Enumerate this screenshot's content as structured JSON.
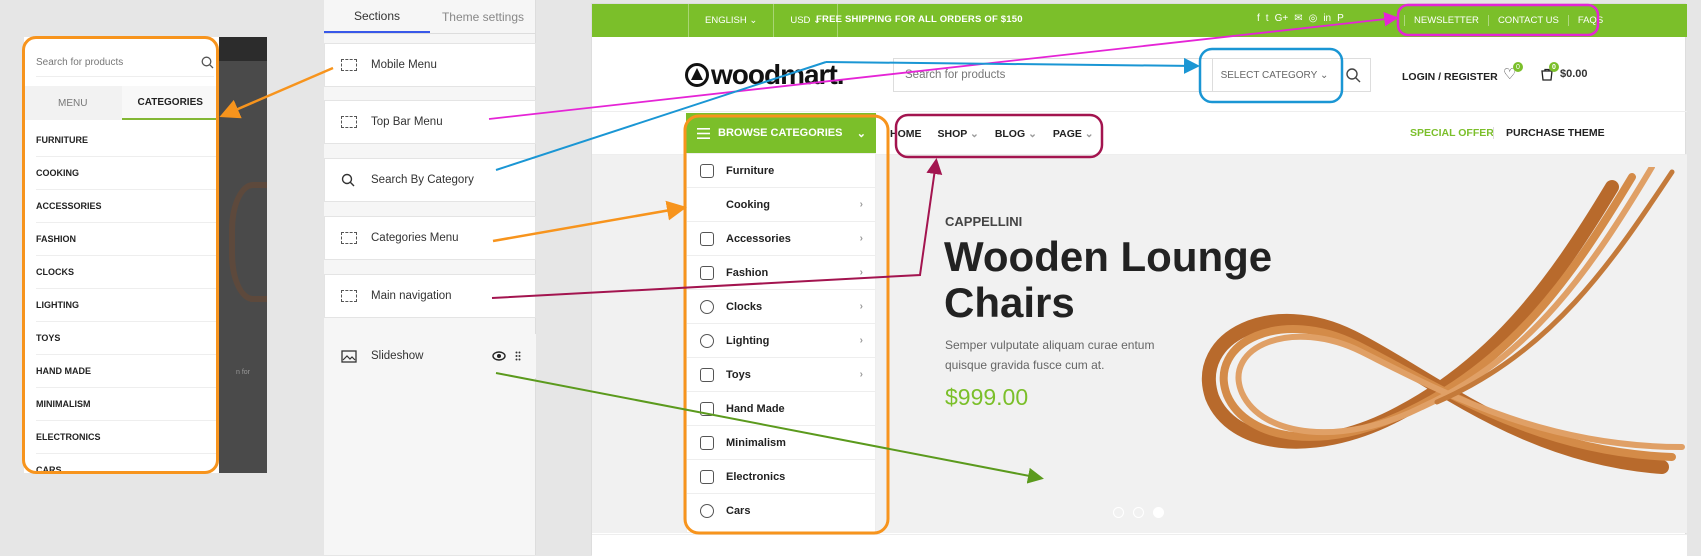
{
  "mobile": {
    "search_placeholder": "Search for products",
    "tabs": [
      {
        "label": "MENU"
      },
      {
        "label": "CATEGORIES"
      }
    ],
    "items": [
      "FURNITURE",
      "COOKING",
      "ACCESSORIES",
      "FASHION",
      "CLOCKS",
      "LIGHTING",
      "TOYS",
      "HAND MADE",
      "MINIMALISM",
      "ELECTRONICS",
      "CARS"
    ],
    "bg_text": "n for"
  },
  "sections": {
    "tabs": [
      {
        "label": "Sections"
      },
      {
        "label": "Theme settings"
      }
    ],
    "items": [
      {
        "label": "Mobile Menu",
        "icon": "section-icon"
      },
      {
        "label": "Top Bar Menu",
        "icon": "section-icon"
      },
      {
        "label": "Search By Category",
        "icon": "search-icon"
      },
      {
        "label": "Categories Menu",
        "icon": "section-icon"
      },
      {
        "label": "Main navigation",
        "icon": "section-icon"
      },
      {
        "label": "Slideshow",
        "icon": "slideshow-icon"
      }
    ]
  },
  "site": {
    "topbar": {
      "language": "ENGLISH",
      "currency": "USD",
      "shipping": "FREE SHIPPING FOR ALL ORDERS OF $150",
      "social": [
        "f",
        "t",
        "G+",
        "✉",
        "◎",
        "in",
        "P"
      ],
      "links": [
        "NEWSLETTER",
        "CONTACT US",
        "FAQS"
      ]
    },
    "header": {
      "logo": "woodmart.",
      "search_placeholder": "Search for products",
      "category_select": "SELECT CATEGORY",
      "login": "LOGIN / REGISTER",
      "wishlist_count": "0",
      "cart_count": "0",
      "cart_total": "$0.00"
    },
    "nav": {
      "browse": "BROWSE CATEGORIES",
      "items": [
        {
          "label": "HOME"
        },
        {
          "label": "SHOP"
        },
        {
          "label": "BLOG"
        },
        {
          "label": "PAGE"
        }
      ],
      "special_offer": "SPECIAL OFFER",
      "purchase": "PURCHASE THEME"
    },
    "categories": [
      "Furniture",
      "Cooking",
      "Accessories",
      "Fashion",
      "Clocks",
      "Lighting",
      "Toys",
      "Hand Made",
      "Minimalism",
      "Electronics",
      "Cars"
    ],
    "hero": {
      "brand": "CAPPELLINI",
      "title": "Wooden Lounge Chairs",
      "description": "Semper vulputate aliquam curae entum quisque gravida fusce cum at.",
      "price": "$999.00",
      "slides": 3,
      "active_slide": 3
    }
  },
  "colors": {
    "accent_green": "#7bbf2a",
    "orange": "#f7941d",
    "magenta": "#e524d6",
    "blue": "#1a96d4",
    "maroon": "#a3144f",
    "arrow_green": "#5b9a1d"
  }
}
